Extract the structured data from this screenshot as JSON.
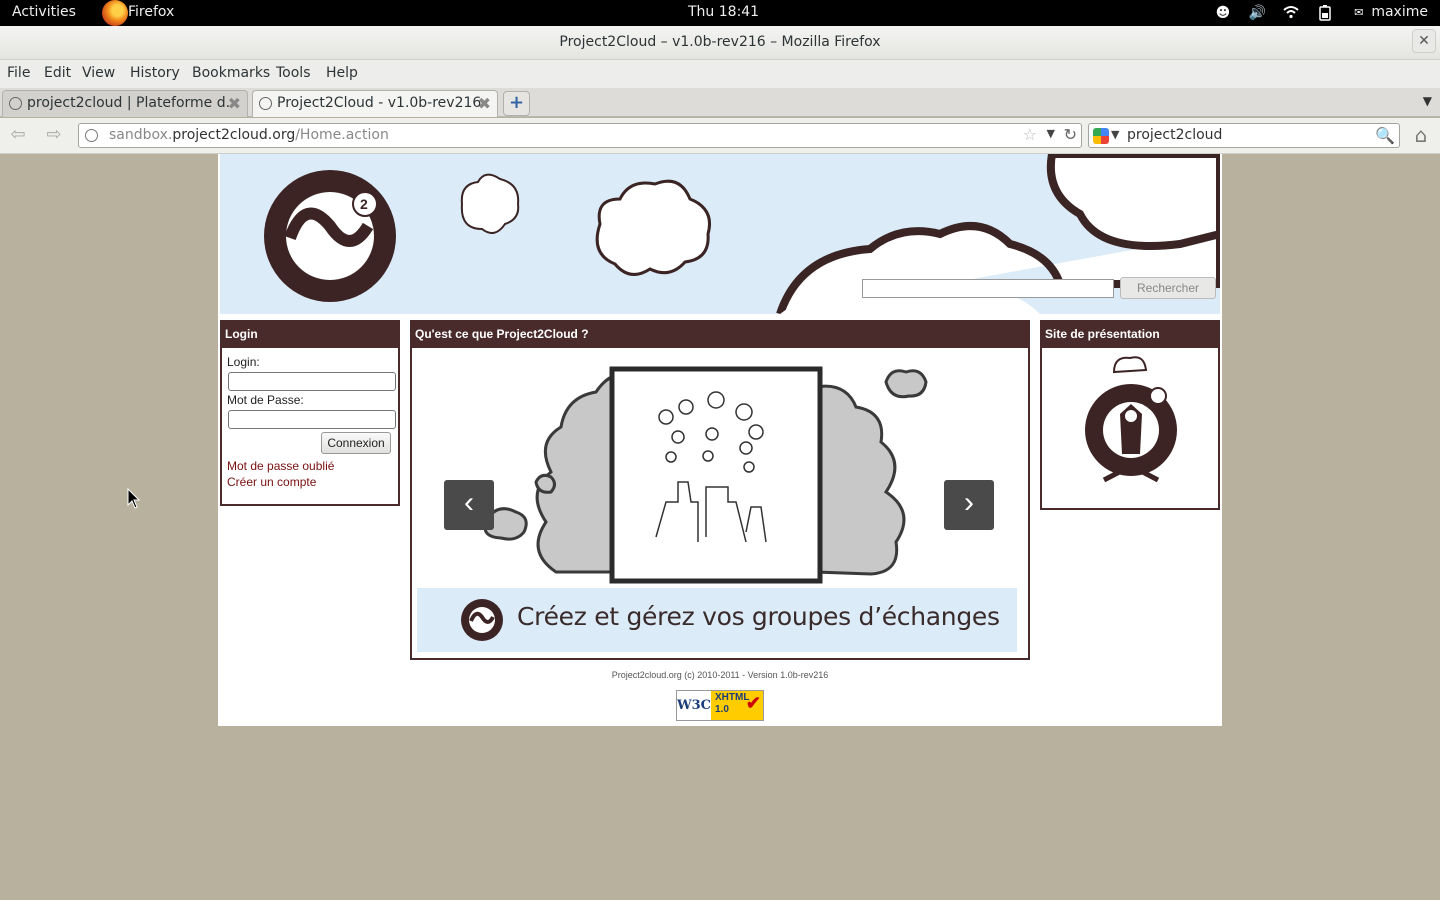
{
  "topbar": {
    "activities": "Activities",
    "app_name": "Firefox",
    "clock": "Thu 18:41",
    "user": "maxime",
    "icons": [
      "accessibility-icon",
      "volume-icon",
      "wifi-icon",
      "battery-icon",
      "user-status-icon"
    ]
  },
  "window": {
    "title": "Project2Cloud – v1.0b-rev216 – Mozilla Firefox",
    "close": "✕"
  },
  "menubar": {
    "items": [
      "File",
      "Edit",
      "View",
      "History",
      "Bookmarks",
      "Tools",
      "Help"
    ]
  },
  "tabs": [
    {
      "label": "project2cloud | Plateforme d...",
      "active": false
    },
    {
      "label": "Project2Cloud - v1.0b-rev216",
      "active": true
    }
  ],
  "navbar": {
    "url_prefix": "sandbox.",
    "url_host": "project2cloud.org",
    "url_path": "/Home.action",
    "search_value": "project2cloud"
  },
  "page": {
    "search_button": "Rechercher",
    "login": {
      "title": "Login",
      "login_label": "Login:",
      "password_label": "Mot de Passe:",
      "submit": "Connexion",
      "forgot_link": "Mot de passe oublié",
      "create_link": "Créer un compte"
    },
    "main": {
      "title": "Qu'est ce que Project2Cloud ?",
      "caption": "Créez et gérez vos groupes d’échanges"
    },
    "presentation": {
      "title": "Site de présentation"
    },
    "footer": "Project2cloud.org (c) 2010-2011 - Version 1.0b-rev216",
    "badge": {
      "w3c": "W3C",
      "xhtml": "XHTML",
      "version": "1.0"
    }
  },
  "colors": {
    "brand_dark": "#4a2b2b",
    "banner_blue": "#dcebf8",
    "desktop_bg": "#b7b19d",
    "link": "#7a1010"
  }
}
